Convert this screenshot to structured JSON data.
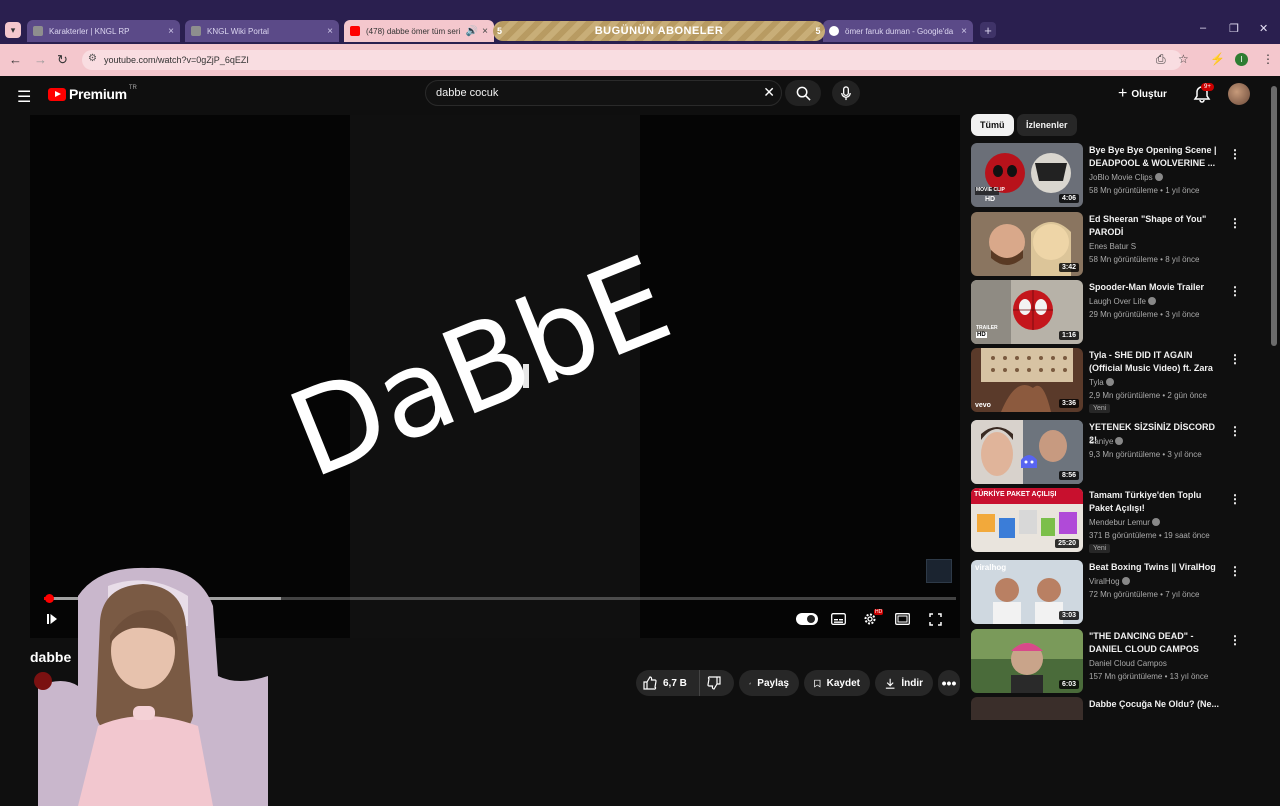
{
  "browser": {
    "tabs": [
      {
        "title": "Karakterler | KNGL RP"
      },
      {
        "title": "KNGL Wiki Portal"
      },
      {
        "title": "(478) dabbe ömer tüm seri"
      },
      {
        "title": "ömer faruk duman - Google'da"
      }
    ],
    "banner": {
      "text": "BUGÜNÜN ABONELER",
      "left_num": "5",
      "right_num": "5"
    },
    "url": "youtube.com/watch?v=0gZjP_6qEZI",
    "profile_initial": "I"
  },
  "youtube": {
    "logo_text": "Premium",
    "country": "TR",
    "search_query": "dabbe cocuk",
    "create_label": "Oluştur",
    "notif_count": "9+",
    "video": {
      "overlay_text": "DaBbE",
      "title": "dabbe",
      "progress_played": 0.005,
      "progress_buffered": 0.26
    },
    "actions": {
      "likes": "6,7 B",
      "share": "Paylaş",
      "save": "Kaydet",
      "download": "İndir"
    },
    "chips": [
      "Tümü",
      "İzlenenler"
    ],
    "recs": [
      {
        "title": "Bye Bye Bye Opening Scene | DEADPOOL & WOLVERINE ...",
        "channel": "JoBlo Movie Clips",
        "views": "58 Mn görüntüleme",
        "age": "1 yıl önce",
        "duration": "4:06",
        "verified": true,
        "new": ""
      },
      {
        "title": "Ed Sheeran \"Shape of You\" PARODİ",
        "channel": "Enes Batur S",
        "views": "58 Mn görüntüleme",
        "age": "8 yıl önce",
        "duration": "3:42",
        "verified": false,
        "new": ""
      },
      {
        "title": "Spooder-Man Movie Trailer",
        "channel": "Laugh Over Life",
        "views": "29 Mn görüntüleme",
        "age": "3 yıl önce",
        "duration": "1:16",
        "verified": true,
        "new": ""
      },
      {
        "title": "Tyla - SHE DID IT AGAIN (Official Music Video) ft. Zara ...",
        "channel": "Tyla",
        "views": "2,9 Mn görüntüleme",
        "age": "2 gün önce",
        "duration": "3:36",
        "verified": true,
        "new": "Yeni"
      },
      {
        "title": "YETENEK SİZSİNİZ DİSCORD 2!",
        "channel": "Saniye",
        "views": "9,3 Mn görüntüleme",
        "age": "3 yıl önce",
        "duration": "8:56",
        "verified": true,
        "new": ""
      },
      {
        "title": "Tamamı Türkiye'den Toplu Paket Açılışı!",
        "channel": "Mendebur Lemur",
        "views": "371 B görüntüleme",
        "age": "19 saat önce",
        "duration": "25:20",
        "verified": true,
        "new": "Yeni"
      },
      {
        "title": "Beat Boxing Twins || ViralHog",
        "channel": "ViralHog",
        "views": "72 Mn görüntüleme",
        "age": "7 yıl önce",
        "duration": "3:03",
        "verified": true,
        "new": ""
      },
      {
        "title": "\"THE DANCING DEAD\" - DANIEL CLOUD CAMPOS",
        "channel": "Daniel Cloud Campos",
        "views": "157 Mn görüntüleme",
        "age": "13 yıl önce",
        "duration": "6:03",
        "verified": false,
        "new": ""
      },
      {
        "title": "Dabbe Çocuğa Ne Oldu? (Ne...",
        "channel": "",
        "views": "",
        "age": "",
        "duration": "",
        "verified": false,
        "new": ""
      }
    ],
    "thumb_texts": {
      "movie_clip": "MOVIE CLIP",
      "hd": "HD",
      "trailer": "TRAILER",
      "vevo": "vevo",
      "turkiye": "TÜRKİYE PAKET AÇILIŞI",
      "viralhog": "viralhog"
    }
  },
  "colors": {
    "accent": "#ff0000",
    "tab_active": "#f4c7cd",
    "tab_bar": "#2a1f4f"
  }
}
